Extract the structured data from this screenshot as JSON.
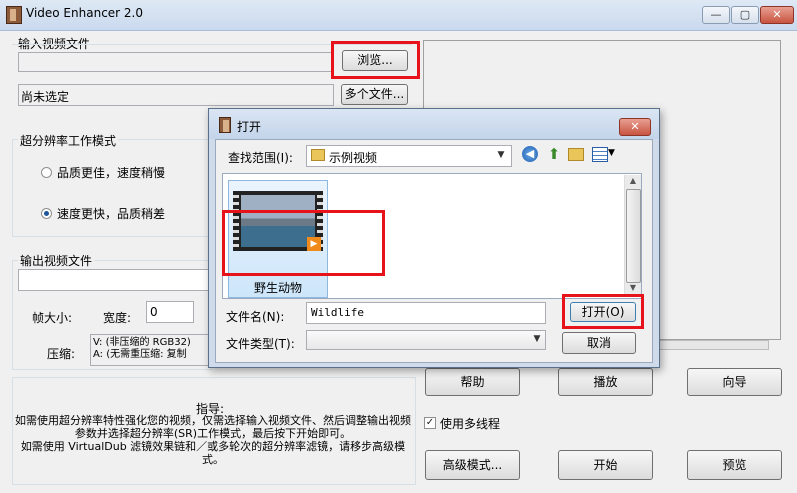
{
  "window": {
    "title": "Video Enhancer 2.0",
    "minimize": "—",
    "maximize": "▢",
    "close": "✕"
  },
  "input": {
    "group_label": "输入视频文件",
    "browse_label": "浏览...",
    "status": "尚未选定",
    "multi_label": "多个文件..."
  },
  "mode": {
    "group_label": "超分辨率工作模式",
    "option_quality": "品质更佳，速度稍慢",
    "option_speed": "速度更快，品质稍差"
  },
  "output": {
    "group_label": "输出视频文件",
    "frame_size_label": "帧大小:",
    "width_label": "宽度:",
    "width_value": "0",
    "compress_label": "压缩:",
    "compress_line1": "V: (非压缩的 RGB32)",
    "compress_line2": "A: (无需重压缩: 复制"
  },
  "guide": {
    "title": "指导:",
    "text1": "如需使用超分辨率特性强化您的视频，仅需选择输入视频文件、然后调整输出视频参数并选择超分辨率(SR)工作模式，最后按下开始即可。",
    "text2": "如需使用 VirtualDub 滤镜效果链和／或多轮次的超分辨率滤镜，请移步高级模式。"
  },
  "buttons": {
    "help": "帮助",
    "play": "播放",
    "wizard": "向导",
    "multithread": "使用多线程",
    "advanced": "高级模式...",
    "start": "开始",
    "preview": "预览"
  },
  "dialog": {
    "title": "打开",
    "look_in_label": "查找范围(I):",
    "look_in_value": "示例视频",
    "file_item": "野生动物",
    "filename_label": "文件名(N):",
    "filename_value": "Wildlife",
    "filetype_label": "文件类型(T):",
    "open_label": "打开(O)",
    "cancel_label": "取消"
  },
  "colors": {
    "highlight_red": "#e8121a",
    "window_bg": "#f0f0f0"
  }
}
